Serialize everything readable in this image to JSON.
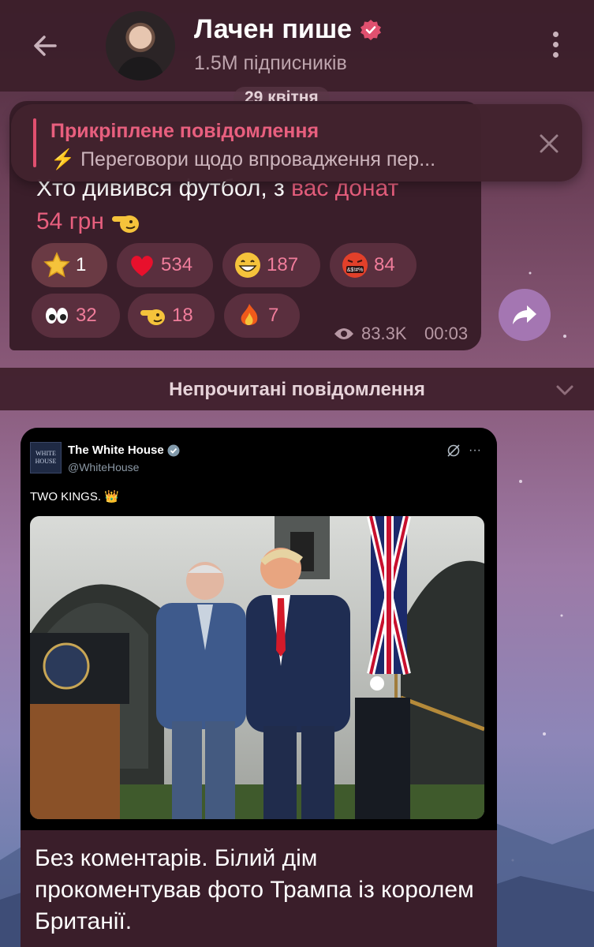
{
  "header": {
    "channel_name": "Лачен пише",
    "subscribers": "1.5M підписників"
  },
  "date_pill": "29 квітня",
  "pinned": {
    "title": "Прикріплене повідомлення",
    "text": "⚡ Переговори щодо впровадження пер..."
  },
  "message1": {
    "line1": "Хто дивився футбол, з ",
    "line1_red": "вас донат",
    "line2": "54 грн",
    "reactions": [
      {
        "emoji": "star-icon",
        "count": "1"
      },
      {
        "emoji": "heart-icon",
        "count": "534"
      },
      {
        "emoji": "grin-icon",
        "count": "187"
      },
      {
        "emoji": "swearing-face-icon",
        "count": "84"
      },
      {
        "emoji": "eyes-icon",
        "count": "32"
      },
      {
        "emoji": "pointing-hand-icon",
        "count": "18"
      },
      {
        "emoji": "fire-icon",
        "count": "7"
      }
    ],
    "views": "83.3K",
    "time": "00:03"
  },
  "unread_label": "Непрочитані повідомлення",
  "message2": {
    "tweet": {
      "account_name": "The White House",
      "handle": "@WhiteHouse",
      "text": "TWO KINGS. 👑",
      "logo_text": "WHITE HOUSE"
    },
    "caption": "Без коментарів. Білий дім прокоментував фото Трампа із королем Британії."
  },
  "colors": {
    "accent": "#e85f7e",
    "bubble": "#3a1e2a",
    "share": "#a476b2"
  }
}
